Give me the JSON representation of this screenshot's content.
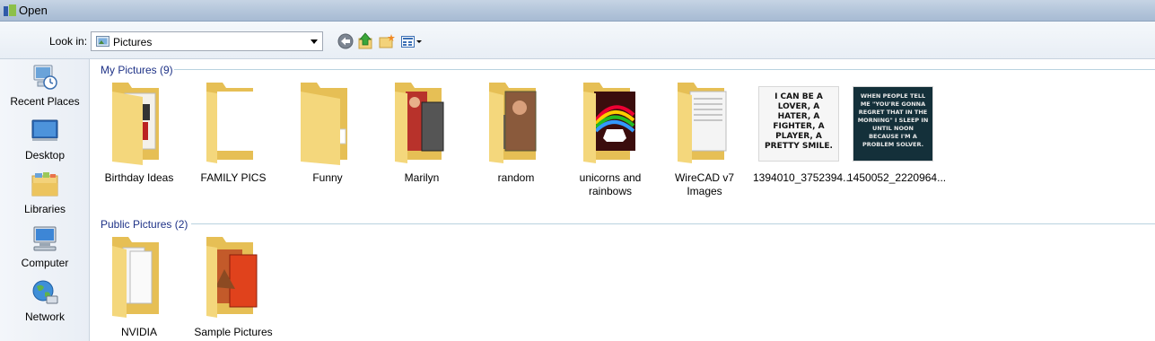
{
  "window": {
    "title": "Open"
  },
  "toolbar": {
    "look_in_label": "Look in:",
    "look_in_value": "Pictures",
    "buttons": [
      "back-icon",
      "up-folder-icon",
      "new-folder-icon",
      "views-menu-icon"
    ]
  },
  "places": [
    {
      "label": "Recent Places",
      "icon": "recent-places-icon"
    },
    {
      "label": "Desktop",
      "icon": "desktop-icon"
    },
    {
      "label": "Libraries",
      "icon": "libraries-icon"
    },
    {
      "label": "Computer",
      "icon": "computer-icon"
    },
    {
      "label": "Network",
      "icon": "network-icon"
    }
  ],
  "groups": [
    {
      "header": "My Pictures (9)",
      "items": [
        {
          "label": "Birthday Ideas",
          "kind": "folder"
        },
        {
          "label": "FAMILY PICS",
          "kind": "folder"
        },
        {
          "label": "Funny",
          "kind": "folder"
        },
        {
          "label": "Marilyn",
          "kind": "folder"
        },
        {
          "label": "random",
          "kind": "folder"
        },
        {
          "label": "unicorns and rainbows",
          "kind": "folder"
        },
        {
          "label": "WireCAD v7 Images",
          "kind": "folder"
        },
        {
          "label": "1394010_3752394...",
          "kind": "image",
          "image_text": "I CAN BE A LOVER, A HATER, A FIGHTER, A PLAYER, A PRETTY SMILE."
        },
        {
          "label": "1450052_2220964...",
          "kind": "image",
          "image_text": "WHEN PEOPLE TELL ME \"YOU'RE GONNA REGRET THAT IN THE MORNING\" I SLEEP IN UNTIL NOON BECAUSE I'M A PROBLEM SOLVER."
        }
      ]
    },
    {
      "header": "Public Pictures (2)",
      "items": [
        {
          "label": "NVIDIA",
          "kind": "folder"
        },
        {
          "label": "Sample Pictures",
          "kind": "folder"
        }
      ]
    }
  ],
  "colors": {
    "group_header": "#1e3287",
    "folder": "#f4d77c",
    "folder_dark": "#e6bf55"
  }
}
